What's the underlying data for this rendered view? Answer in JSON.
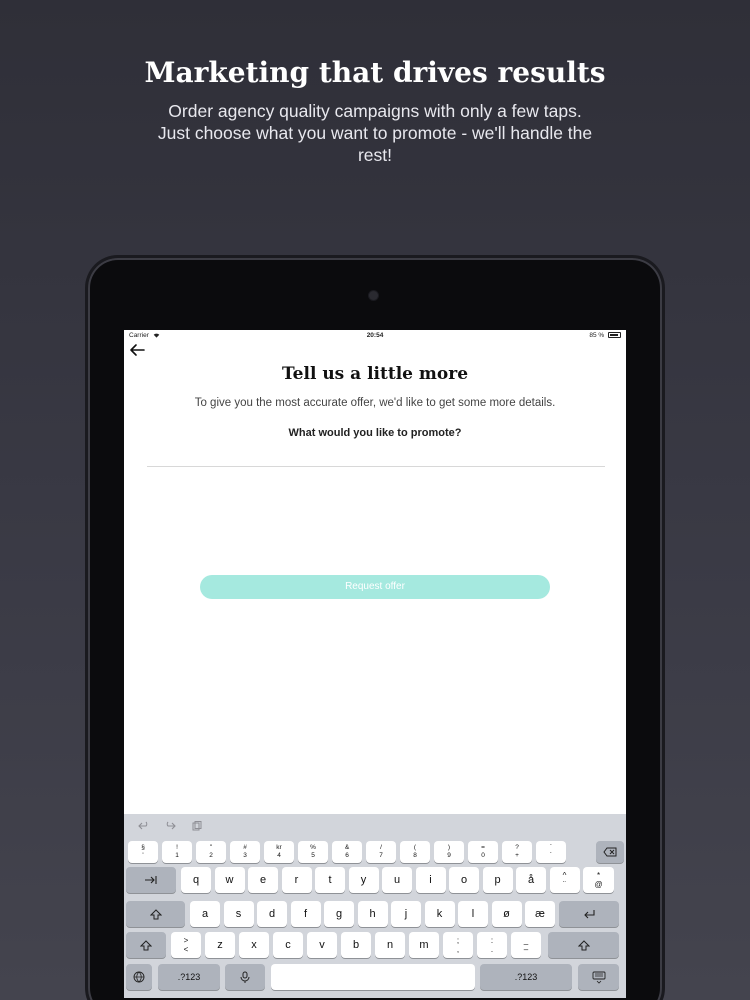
{
  "promo": {
    "headline": "Marketing that drives results",
    "subline": "Order agency quality campaigns with only a few taps. Just choose what you want to promote - we'll handle the rest!"
  },
  "status_bar": {
    "carrier": "Carrier",
    "time": "20:54",
    "battery": "85 %"
  },
  "screen": {
    "title": "Tell us a little more",
    "description": "To give you the most accurate offer, we'd like to get some more details.",
    "question": "What would you like to promote?",
    "input_value": "",
    "input_placeholder": "",
    "request_button_label": "Request offer"
  },
  "keyboard": {
    "number_row": [
      {
        "top": "§",
        "bottom": "'"
      },
      {
        "top": "!",
        "bottom": "1"
      },
      {
        "top": "\"",
        "bottom": "2"
      },
      {
        "top": "#",
        "bottom": "3"
      },
      {
        "top": "kr",
        "bottom": "4"
      },
      {
        "top": "%",
        "bottom": "5"
      },
      {
        "top": "&",
        "bottom": "6"
      },
      {
        "top": "/",
        "bottom": "7"
      },
      {
        "top": "(",
        "bottom": "8"
      },
      {
        "top": ")",
        "bottom": "9"
      },
      {
        "top": "=",
        "bottom": "0"
      },
      {
        "top": "?",
        "bottom": "+"
      },
      {
        "top": "`",
        "bottom": "´"
      }
    ],
    "row_q": [
      "q",
      "w",
      "e",
      "r",
      "t",
      "y",
      "u",
      "i",
      "o",
      "p",
      "å"
    ],
    "row_q_extra": {
      "top": "^",
      "bottom": "¨"
    },
    "row_q_last": {
      "top": "*",
      "bottom": "@"
    },
    "row_a": [
      "a",
      "s",
      "d",
      "f",
      "g",
      "h",
      "j",
      "k",
      "l",
      "ø",
      "æ"
    ],
    "row_z_first": {
      "top": ">",
      "bottom": "<"
    },
    "row_z": [
      "z",
      "x",
      "c",
      "v",
      "b",
      "n",
      "m"
    ],
    "row_z_punct": [
      {
        "top": ";",
        "bottom": ","
      },
      {
        "top": ":",
        "bottom": "."
      },
      {
        "top": "_",
        "bottom": "–"
      }
    ],
    "numbers_label_left": ".?123",
    "numbers_label_right": ".?123"
  }
}
